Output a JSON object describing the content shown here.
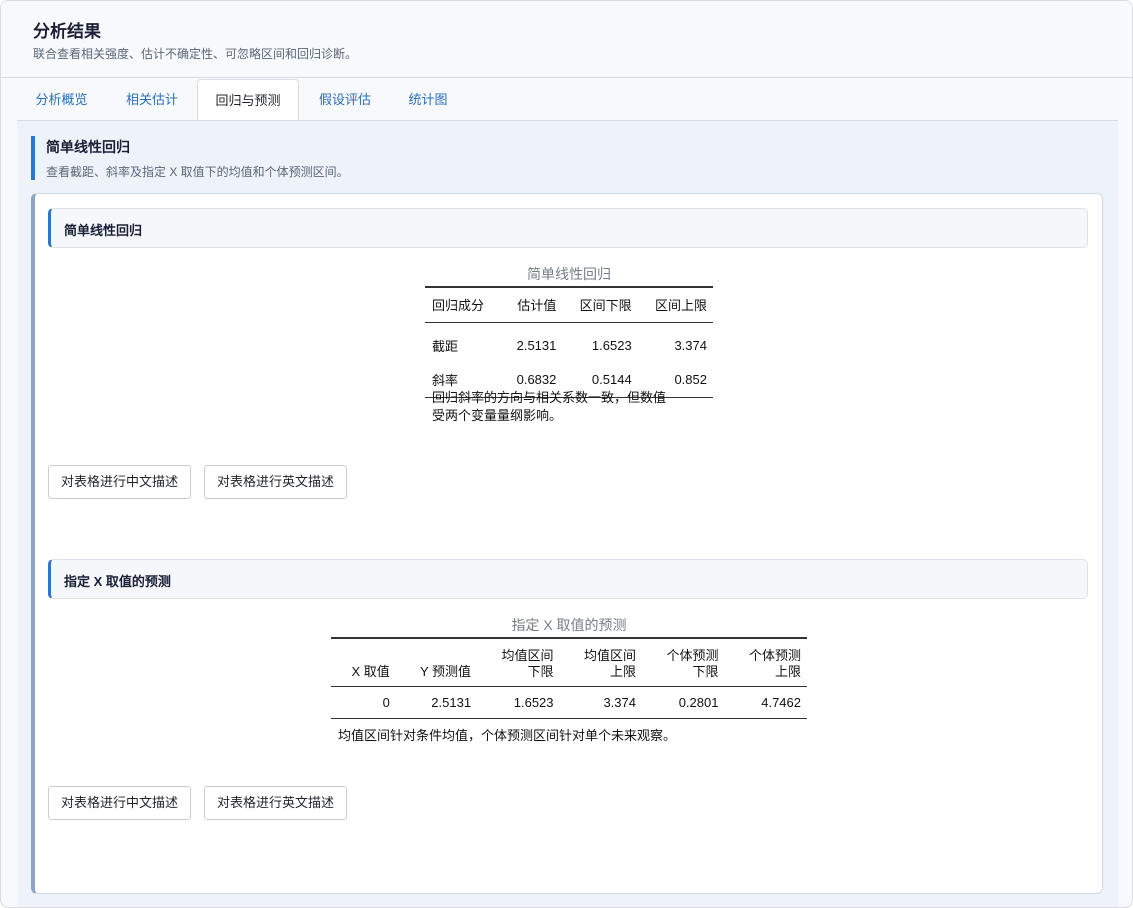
{
  "header": {
    "title": "分析结果",
    "subtitle": "联合查看相关强度、估计不确定性、可忽略区间和回归诊断。"
  },
  "tabs": [
    {
      "label": "分析概览",
      "active": false
    },
    {
      "label": "相关估计",
      "active": false
    },
    {
      "label": "回归与预测",
      "active": true
    },
    {
      "label": "假设评估",
      "active": false
    },
    {
      "label": "统计图",
      "active": false
    }
  ],
  "section": {
    "title": "简单线性回归",
    "subtitle": "查看截距、斜率及指定 X 取值下的均值和个体预测区间。"
  },
  "regression": {
    "heading": "简单线性回归",
    "table_title": "简单线性回归",
    "columns": [
      "回归成分",
      "估计值",
      "区间下限",
      "区间上限"
    ],
    "rows": [
      [
        "截距",
        "2.5131",
        "1.6523",
        "3.374"
      ],
      [
        "斜率",
        "0.6832",
        "0.5144",
        "0.852"
      ]
    ],
    "note_line1": "回归斜率的方向与相关系数一致，但数值",
    "note_line2": "受两个变量量纲影响。"
  },
  "prediction": {
    "heading": "指定 X 取值的预测",
    "table_title": "指定 X 取值的预测",
    "columns": [
      {
        "l1": "",
        "l2": "X 取值"
      },
      {
        "l1": "",
        "l2": "Y 预测值"
      },
      {
        "l1": "均值区间",
        "l2": "下限"
      },
      {
        "l1": "均值区间",
        "l2": "上限"
      },
      {
        "l1": "个体预测",
        "l2": "下限"
      },
      {
        "l1": "个体预测",
        "l2": "上限"
      }
    ],
    "rows": [
      [
        "0",
        "2.5131",
        "1.6523",
        "3.374",
        "0.2801",
        "4.7462"
      ]
    ],
    "note": "均值区间针对条件均值，个体预测区间针对单个未来观察。"
  },
  "buttons": {
    "describe_zh": "对表格进行中文描述",
    "describe_en": "对表格进行英文描述"
  }
}
